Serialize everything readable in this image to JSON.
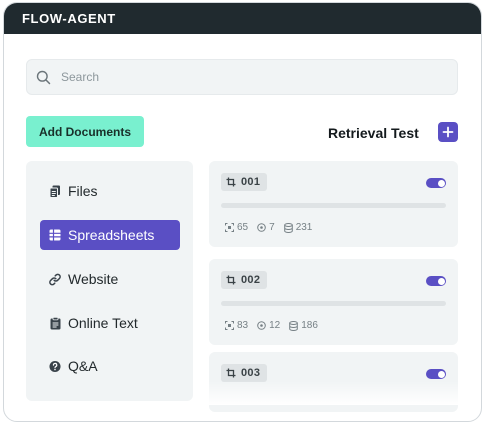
{
  "app": {
    "title": "FLOW-AGENT"
  },
  "search": {
    "placeholder": "Search",
    "value": ""
  },
  "toolbar": {
    "add_documents_label": "Add Documents",
    "retrieval_test_label": "Retrieval Test"
  },
  "sidebar": {
    "items": [
      {
        "label": "Files",
        "icon": "files-icon",
        "active": false
      },
      {
        "label": "Spreadsheets",
        "icon": "table-icon",
        "active": true
      },
      {
        "label": "Website",
        "icon": "link-icon",
        "active": false
      },
      {
        "label": "Online Text",
        "icon": "clipboard-icon",
        "active": false
      },
      {
        "label": "Q&A",
        "icon": "question-icon",
        "active": false
      }
    ]
  },
  "chunks": [
    {
      "id": "001",
      "enabled": true,
      "stats": {
        "a": "65",
        "b": "7",
        "c": "231"
      }
    },
    {
      "id": "002",
      "enabled": true,
      "stats": {
        "a": "83",
        "b": "12",
        "c": "186"
      }
    },
    {
      "id": "003",
      "enabled": true
    }
  ],
  "colors": {
    "accent": "#5a4fc4",
    "add_button": "#79f0cf",
    "titlebar": "#202a2f",
    "panel": "#f1f4f5"
  }
}
